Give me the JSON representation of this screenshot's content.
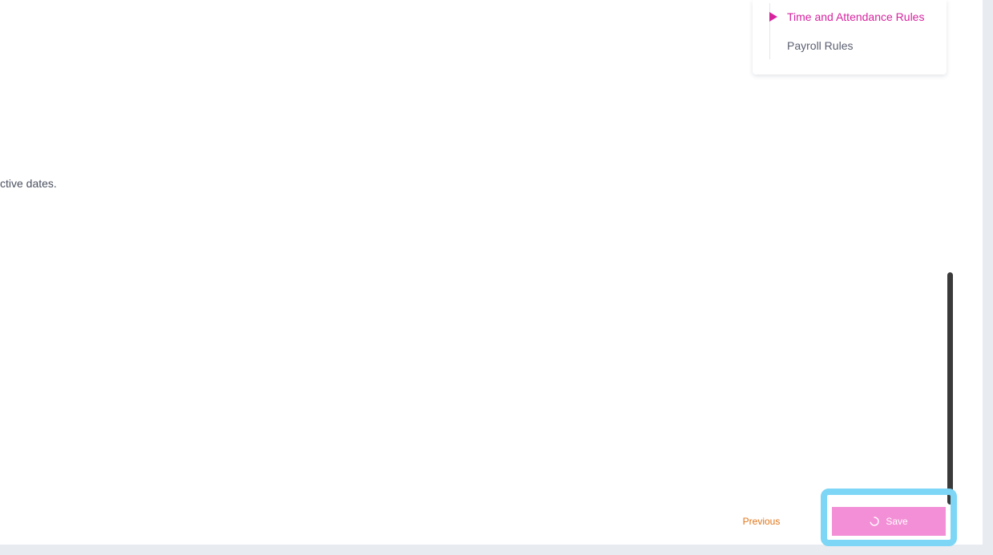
{
  "content": {
    "body_text": "ctive dates."
  },
  "section_nav": {
    "items": [
      {
        "label": "Time and Attendance Rules",
        "active": true
      },
      {
        "label": "Payroll Rules",
        "active": false
      }
    ],
    "active_marker_icon": "caret-right-icon",
    "active_color": "#d6249f"
  },
  "footer": {
    "previous_label": "Previous",
    "save_label": "Save",
    "save_icon": "loading-spinner-icon",
    "previous_color": "#e0751a",
    "save_color": "#f38fd6",
    "highlight_color": "#7dd6f5"
  }
}
